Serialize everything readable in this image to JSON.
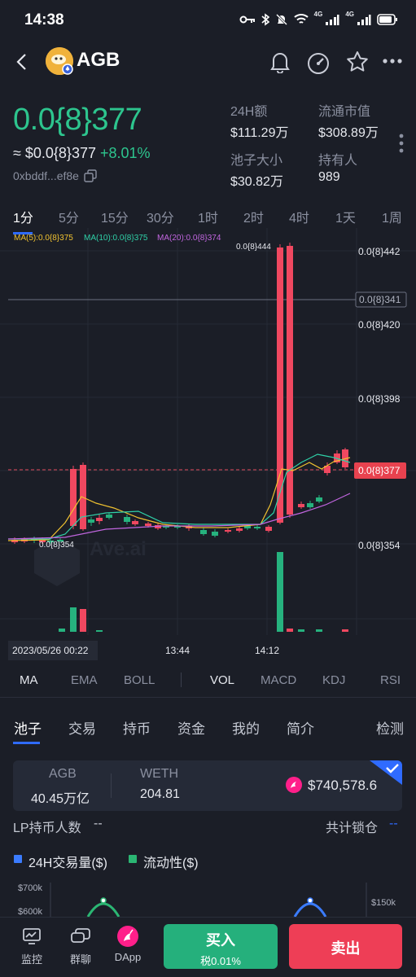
{
  "status": {
    "time": "14:38",
    "network_a": "4G",
    "network_b": "4G"
  },
  "header": {
    "token": "AGB"
  },
  "price": {
    "main": "0.0{8}377",
    "approx": "≈ $0.0{8}377",
    "change": "+8.01%",
    "address": "0xbddf...ef8e"
  },
  "stats": {
    "vol_label": "24H额",
    "vol_value": "$111.29万",
    "mcap_label": "流通市值",
    "mcap_value": "$308.89万",
    "pool_label": "池子大小",
    "pool_value": "$30.82万",
    "holders_label": "持有人",
    "holders_value": "989"
  },
  "timeframes": [
    "1分",
    "5分",
    "15分",
    "30分",
    "1时",
    "2时",
    "4时",
    "1天",
    "1周"
  ],
  "chart": {
    "ma5": "MA(5):0.0{8}375",
    "ma10": "MA(10):0.0{8}375",
    "ma20": "MA(20):0.0{8}374",
    "y_labels": [
      "0.0{8}442",
      "0.0{8}420",
      "0.0{8}398",
      "0.0{8}354"
    ],
    "crosshair_label": "0.0{8}341",
    "current_label": "0.0{8}377",
    "high_label": "0.0{8}444",
    "low_label": "0.0{8}354",
    "watermark": "Ave.ai",
    "x_labels": [
      "2023/05/26 00:22",
      "13:44",
      "14:12"
    ],
    "colors": {
      "up": "#26b27e",
      "down": "#f04860",
      "ma5": "#f0c230",
      "ma10": "#2fd1a8",
      "ma20": "#c266e0"
    }
  },
  "indicators_main": [
    "MA",
    "EMA",
    "BOLL"
  ],
  "indicators_sub": [
    "VOL",
    "MACD",
    "KDJ",
    "RSI"
  ],
  "tabs": [
    "池子",
    "交易",
    "持币",
    "资金",
    "我的",
    "简介"
  ],
  "tab_right": "检测",
  "pool": {
    "token_a": "AGB",
    "amount_a": "40.45万亿",
    "token_b": "WETH",
    "amount_b": "204.81",
    "usd_value": "$740,578.6"
  },
  "lp": {
    "holders_label": "LP持币人数",
    "holders_value": "--",
    "lock_label": "共计锁仓",
    "lock_value": "--"
  },
  "legend2": {
    "vol": "24H交易量($)",
    "liq": "流动性($)"
  },
  "mini_chart": {
    "y_left": [
      "$700k",
      "$600k"
    ],
    "y_right": [
      "$150k"
    ]
  },
  "bottom": {
    "monitor": "监控",
    "group": "群聊",
    "dapp": "DApp",
    "buy": "买入",
    "buy_tax": "税0.01%",
    "sell": "卖出"
  }
}
